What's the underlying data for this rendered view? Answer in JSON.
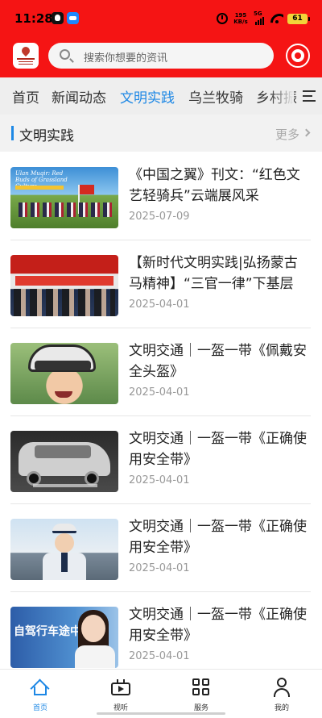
{
  "status_bar": {
    "time": "11:28",
    "net_speed": "195",
    "net_unit": "KB/s",
    "signal_label": "5G",
    "battery": "61"
  },
  "header": {
    "search_placeholder": "搜索你想要的资讯",
    "colors": {
      "header_bg": "#f51414",
      "accent": "#1e88e5"
    }
  },
  "tabs": [
    {
      "label": "首页",
      "active": false
    },
    {
      "label": "新闻动态",
      "active": false
    },
    {
      "label": "文明实践",
      "active": true
    },
    {
      "label": "乌兰牧骑",
      "active": false
    },
    {
      "label": "乡村振",
      "active": false
    }
  ],
  "section": {
    "title": "文明实践",
    "more": "更多"
  },
  "articles": [
    {
      "title": "《中国之翼》刊文：“红色文艺轻骑兵”云端展风采",
      "date": "2025-07-09",
      "thumb_text": "Ulan Muqir: Red Buds of Grassland Culture"
    },
    {
      "title": "【新时代文明实践|弘扬蒙古马精神】“三官一律”下基层",
      "date": "2025-04-01"
    },
    {
      "title": "文明交通｜一盔一带《佩戴安全头盔》",
      "date": "2025-04-01"
    },
    {
      "title": "文明交通｜一盔一带《正确使用安全带》",
      "date": "2025-04-01"
    },
    {
      "title": "文明交通｜一盔一带《正确使用安全带》",
      "date": "2025-04-01"
    },
    {
      "title": "文明交通｜一盔一带《正确使用安全带》",
      "date": "2025-04-01",
      "thumb_text": "自驾行车途中"
    }
  ],
  "bottom_nav": [
    {
      "label": "首页",
      "icon": "home-icon",
      "active": true
    },
    {
      "label": "视听",
      "icon": "video-icon",
      "active": false
    },
    {
      "label": "服务",
      "icon": "grid-icon",
      "active": false
    },
    {
      "label": "我的",
      "icon": "user-icon",
      "active": false
    }
  ]
}
